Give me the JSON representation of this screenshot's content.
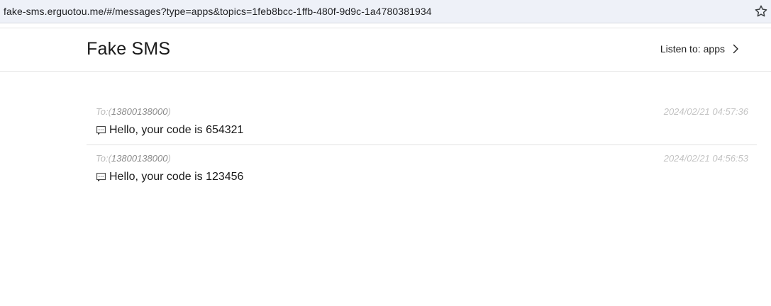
{
  "browser": {
    "url": "fake-sms.erguotou.me/#/messages?type=apps&topics=1feb8bcc-1ffb-480f-9d9c-1a4780381934",
    "bookmark_icon": "star-icon"
  },
  "header": {
    "title": "Fake SMS",
    "listen_prefix": "Listen to:",
    "listen_value": "apps",
    "listen_icon": "chevron-right-icon"
  },
  "messages": [
    {
      "to_prefix": "To:(",
      "to_number": "13800138000",
      "to_suffix": ")",
      "timestamp": "2024/02/21 04:57:36",
      "icon": "message-icon",
      "text": "Hello, your code is 654321"
    },
    {
      "to_prefix": "To:(",
      "to_number": "13800138000",
      "to_suffix": ")",
      "timestamp": "2024/02/21 04:56:53",
      "icon": "message-icon",
      "text": "Hello, your code is 123456"
    }
  ]
}
